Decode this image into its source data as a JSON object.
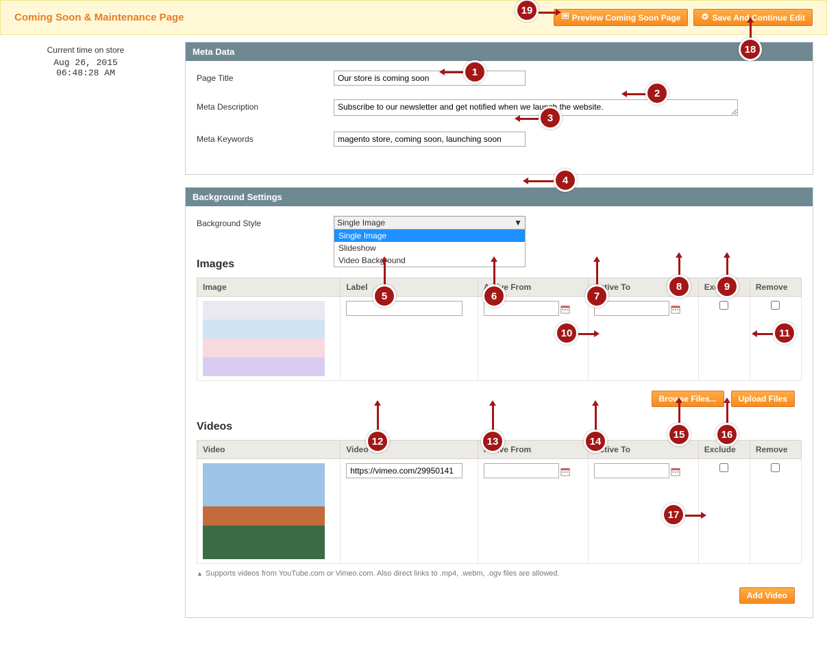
{
  "header": {
    "title": "Coming Soon & Maintenance Page",
    "preview_label": "Preview Coming Soon Page",
    "save_label": "Save And Continue Edit"
  },
  "sidebar": {
    "time_label": "Current time on store",
    "date": "Aug 26, 2015",
    "time": "06:48:28 AM"
  },
  "sections": {
    "meta": {
      "title": "Meta Data",
      "fields": {
        "page_title_label": "Page Title",
        "page_title_value": "Our store is coming soon",
        "meta_desc_label": "Meta Description",
        "meta_desc_value": "Subscribe to our newsletter and get notified when we launch the website.",
        "meta_keywords_label": "Meta Keywords",
        "meta_keywords_value": "magento store, coming soon, launching soon"
      }
    },
    "background": {
      "title": "Background Settings",
      "style_label": "Background Style",
      "style_selected": "Single Image",
      "style_options": [
        "Single Image",
        "Slideshow",
        "Video Background"
      ],
      "images_heading": "Images",
      "videos_heading": "Videos",
      "image_table": {
        "cols": [
          "Image",
          "Label",
          "Active From",
          "Active To",
          "Exclude",
          "Remove"
        ],
        "row": {
          "label": "",
          "active_from": "",
          "active_to": ""
        }
      },
      "video_table": {
        "cols": [
          "Video",
          "Video Url",
          "Active From",
          "Active To",
          "Exclude",
          "Remove"
        ],
        "row": {
          "url": "https://vimeo.com/29950141",
          "active_from": "",
          "active_to": ""
        }
      },
      "browse_label": "Browse Files...",
      "upload_label": "Upload Files",
      "add_video_label": "Add Video",
      "video_hint": "Supports videos from YouTube.com or Vimeo.com. Also direct links to .mp4, .webm, .ogv files are allowed."
    }
  },
  "callouts": {
    "1": "1",
    "2": "2",
    "3": "3",
    "4": "4",
    "5": "5",
    "6": "6",
    "7": "7",
    "8": "8",
    "9": "9",
    "10": "10",
    "11": "11",
    "12": "12",
    "13": "13",
    "14": "14",
    "15": "15",
    "16": "16",
    "17": "17",
    "18": "18",
    "19": "19"
  }
}
